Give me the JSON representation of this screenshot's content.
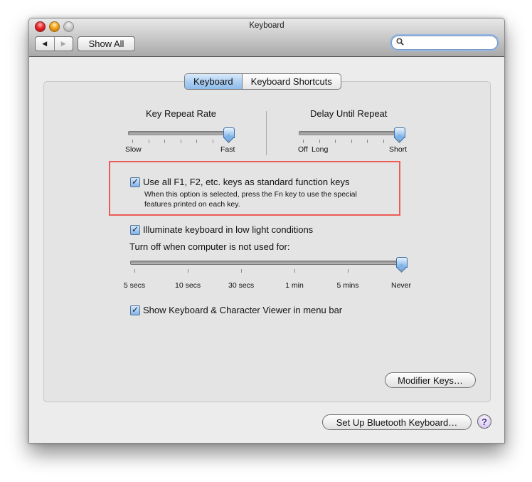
{
  "window": {
    "title": "Keyboard",
    "traffic_lights": [
      "close",
      "minimize",
      "zoom-disabled"
    ]
  },
  "toolbar": {
    "back_icon": "◀",
    "forward_icon": "▶",
    "show_all_label": "Show All",
    "search": {
      "value": "",
      "placeholder": "",
      "icon": "search-icon"
    }
  },
  "tabs": [
    {
      "label": "Keyboard",
      "active": true
    },
    {
      "label": "Keyboard Shortcuts",
      "active": false
    }
  ],
  "key_repeat": {
    "title": "Key Repeat Rate",
    "min_label": "Slow",
    "max_label": "Fast",
    "tick_count": 7,
    "value_fraction": 1.0
  },
  "delay_repeat": {
    "title": "Delay Until Repeat",
    "labels": [
      "Off",
      "Long",
      "Short"
    ],
    "tick_count": 7,
    "value_fraction": 1.0
  },
  "fn_keys": {
    "checked": true,
    "label": "Use all F1, F2, etc. keys as standard function keys",
    "description_line1": "When this option is selected, press the Fn key to use the special",
    "description_line2": "features printed on each key."
  },
  "illuminate": {
    "checked": true,
    "label": "Illuminate keyboard in low light conditions",
    "turn_off_label": "Turn off when computer is not used for:",
    "slider_labels": [
      "5 secs",
      "10 secs",
      "30 secs",
      "1 min",
      "5 mins",
      "Never"
    ],
    "value": "Never"
  },
  "show_viewer": {
    "checked": true,
    "label": "Show Keyboard & Character Viewer in menu bar"
  },
  "buttons": {
    "modifier_keys": "Modifier Keys…",
    "bluetooth": "Set Up Bluetooth Keyboard…",
    "help": "?"
  },
  "checkmark": "✓",
  "search_glyph": "⚲",
  "highlight_color": "#ec5b57"
}
